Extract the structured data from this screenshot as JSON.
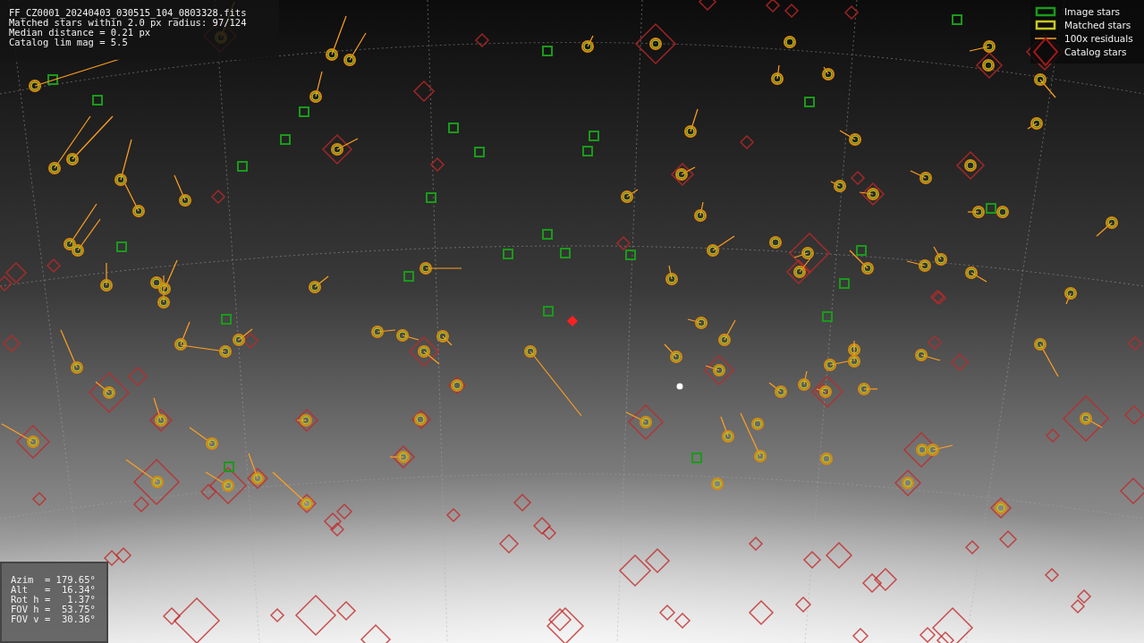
{
  "file_info": {
    "lines": [
      "FF_CZ0001_20240403_030515_104_0803328.fits",
      "Matched stars within 2.0 px radius: 97/124",
      "Median distance = 0.21 px",
      "Catalog lim mag = 5.5"
    ]
  },
  "legend": [
    {
      "kind": "image",
      "label": "Image stars"
    },
    {
      "kind": "matched",
      "label": "Matched stars"
    },
    {
      "kind": "residual",
      "label": "100x residuals"
    },
    {
      "kind": "catalog",
      "label": "Catalog stars"
    }
  ],
  "pointing": {
    "lines": [
      "Azim  = 179.65°",
      "Alt   =  16.34°",
      "Rot h =   1.37°",
      "FOV h =  53.75°",
      "FOV v =  30.36°"
    ]
  }
}
